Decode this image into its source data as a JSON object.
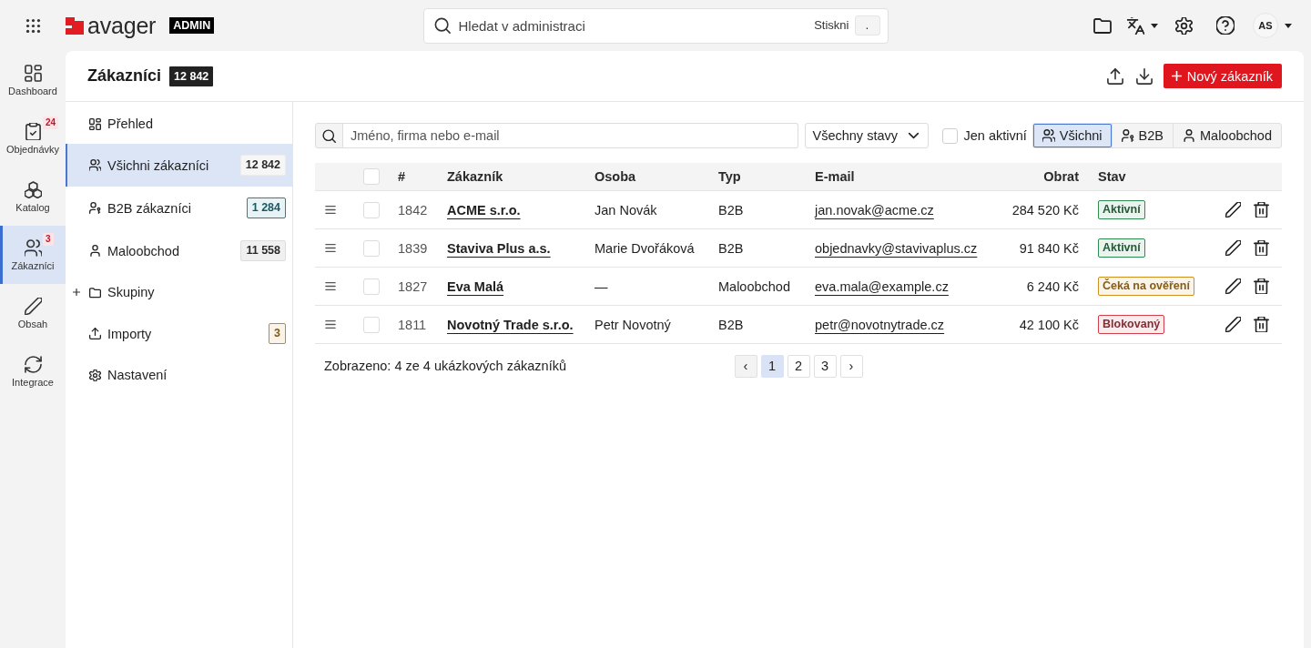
{
  "top_bar": {
    "logo": {
      "text": "avager"
    },
    "badge": "ADMIN",
    "search": {
      "placeholder": "Hledat v administraci",
      "hint": "Stiskni",
      "key": "."
    },
    "avatar": {
      "initials": "AS"
    }
  },
  "rail": [
    {
      "label": "Dashboard",
      "selected": false
    },
    {
      "label": "Objednávky",
      "badge": "24",
      "selected": false
    },
    {
      "label": "Katalog",
      "selected": false
    },
    {
      "label": "Zákazníci",
      "badge": "3",
      "selected": true
    },
    {
      "label": "Obsah",
      "selected": false
    },
    {
      "label": "Integrace",
      "selected": false
    }
  ],
  "header": {
    "title": "Zákazníci",
    "count": "12 842",
    "primary_button": "Nový zákazník"
  },
  "sidebar": [
    {
      "label": "Přehled",
      "selected": false
    },
    {
      "label": "Všichni zákazníci",
      "count": "12 842",
      "color": "#ececec",
      "selected": true
    },
    {
      "label": "B2B zákazníci",
      "count": "1 284",
      "color": "#1b8797",
      "selected": false
    },
    {
      "label": "Maloobchod",
      "count": "11 558",
      "color": "#dddddd",
      "selected": false
    },
    {
      "label": "Skupiny",
      "expanded": false,
      "selected": false
    },
    {
      "label": "Importy",
      "count": "3",
      "color": "#c8891c",
      "selected": false
    },
    {
      "label": "Nastavení",
      "selected": false
    }
  ],
  "filters": {
    "search": {
      "placeholder": "Jméno, firma nebo e-mail"
    },
    "status_select": {
      "value": "Všechny stavy"
    },
    "only_active": {
      "label": "Jen aktivní",
      "checked": false
    },
    "segments": [
      {
        "label": "Všichni",
        "selected": true
      },
      {
        "label": "B2B",
        "selected": false
      },
      {
        "label": "Maloobchod",
        "selected": false
      }
    ]
  },
  "table": {
    "columns": [
      "#",
      "Zákazník",
      "Osoba",
      "Typ",
      "E-mail",
      "Obrat",
      "Stav"
    ],
    "all_checked": false,
    "rows": [
      {
        "id": "1842",
        "customer": "ACME s.r.o.",
        "person": "Jan Novák",
        "type": "B2B",
        "email": "jan.novak@acme.cz",
        "revenue": "284 520 Kč",
        "status": {
          "label": "Aktivní",
          "color": "#2f8a4f"
        },
        "selected": false
      },
      {
        "id": "1839",
        "customer": "Staviva Plus a.s.",
        "person": "Marie Dvořáková",
        "type": "B2B",
        "email": "objednavky@stavivaplus.cz",
        "revenue": "91 840 Kč",
        "status": {
          "label": "Aktivní",
          "color": "#2f8a4f"
        },
        "selected": false
      },
      {
        "id": "1827",
        "customer": "Eva Malá",
        "person": "—",
        "type": "Maloobchod",
        "email": "eva.mala@example.cz",
        "revenue": "6 240 Kč",
        "status": {
          "label": "Čeká na ověření",
          "color": "#d0901f"
        },
        "selected": false
      },
      {
        "id": "1811",
        "customer": "Novotný Trade s.r.o.",
        "person": "Petr Novotný",
        "type": "B2B",
        "email": "petr@novotnytrade.cz",
        "revenue": "42 100 Kč",
        "status": {
          "label": "Blokovaný",
          "color": "#d0404c"
        },
        "selected": false
      }
    ]
  },
  "footer": {
    "summary": "Zobrazeno: 4 ze 4 ukázkových zákazníků",
    "pagination": {
      "prev": "‹",
      "pages": [
        {
          "label": "1",
          "selected": true
        },
        {
          "label": "2",
          "selected": false
        },
        {
          "label": "3",
          "selected": false
        }
      ],
      "next": "›"
    }
  }
}
